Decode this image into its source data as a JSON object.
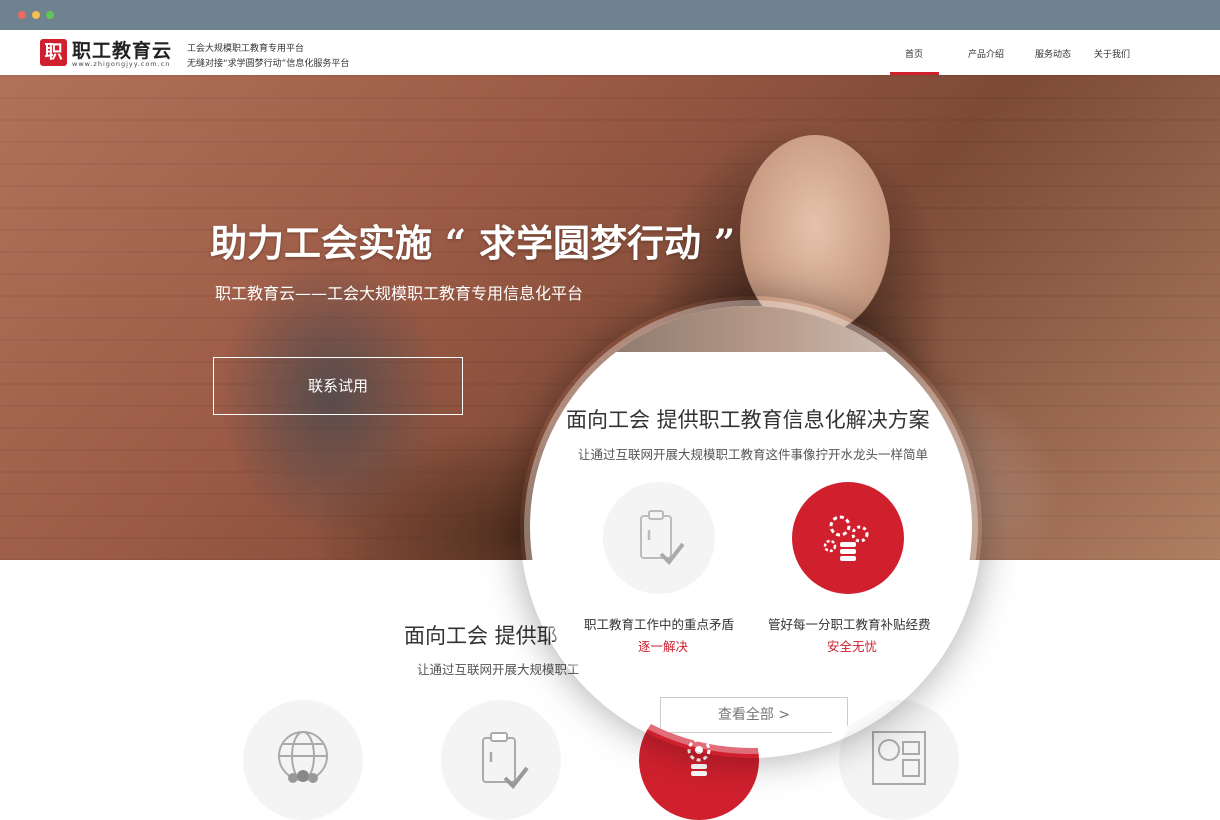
{
  "window": {
    "dots": [
      "close",
      "minimize",
      "maximize"
    ]
  },
  "nav": {
    "logo_mark": "职",
    "logo_text": "职工教育云",
    "logo_url": "www.zhigongjyy.com.cn",
    "tagline_1": "工会大规模职工教育专用平台",
    "tagline_2": "无缝对接“求学圆梦行动”信息化服务平台",
    "menu": [
      {
        "label": "首页",
        "active": true
      },
      {
        "label": "产品介绍"
      },
      {
        "label": "服务动态"
      },
      {
        "label": "关于我们"
      }
    ],
    "accent": "#d0202e"
  },
  "hero": {
    "title": "助力工会实施 “ 求学圆梦行动 ”",
    "subtitle": "职工教育云——工会大规模职工教育专用信息化平台",
    "cta_label": "联系试用"
  },
  "section": {
    "title": "面向工会 提供耶",
    "desc": "让通过互联网开展大规模职工"
  },
  "magnifier": {
    "title": "面向工会 提供职工教育信息化解决方案",
    "desc": "让通过互联网开展大规模职工教育这件事像拧开水龙头一样简单",
    "features": [
      {
        "label": "职工教育工作中的重点矛盾",
        "highlight": "逐一解决",
        "icon": "clipboard-check-icon"
      },
      {
        "label": "管好每一分职工教育补贴经费",
        "highlight": "安全无忧",
        "icon": "gears-database-icon"
      }
    ],
    "button_label": "查看全部  >"
  },
  "icons": [
    "globe-people-icon",
    "clipboard-check-icon",
    "gears-database-icon",
    "id-card-icon"
  ]
}
